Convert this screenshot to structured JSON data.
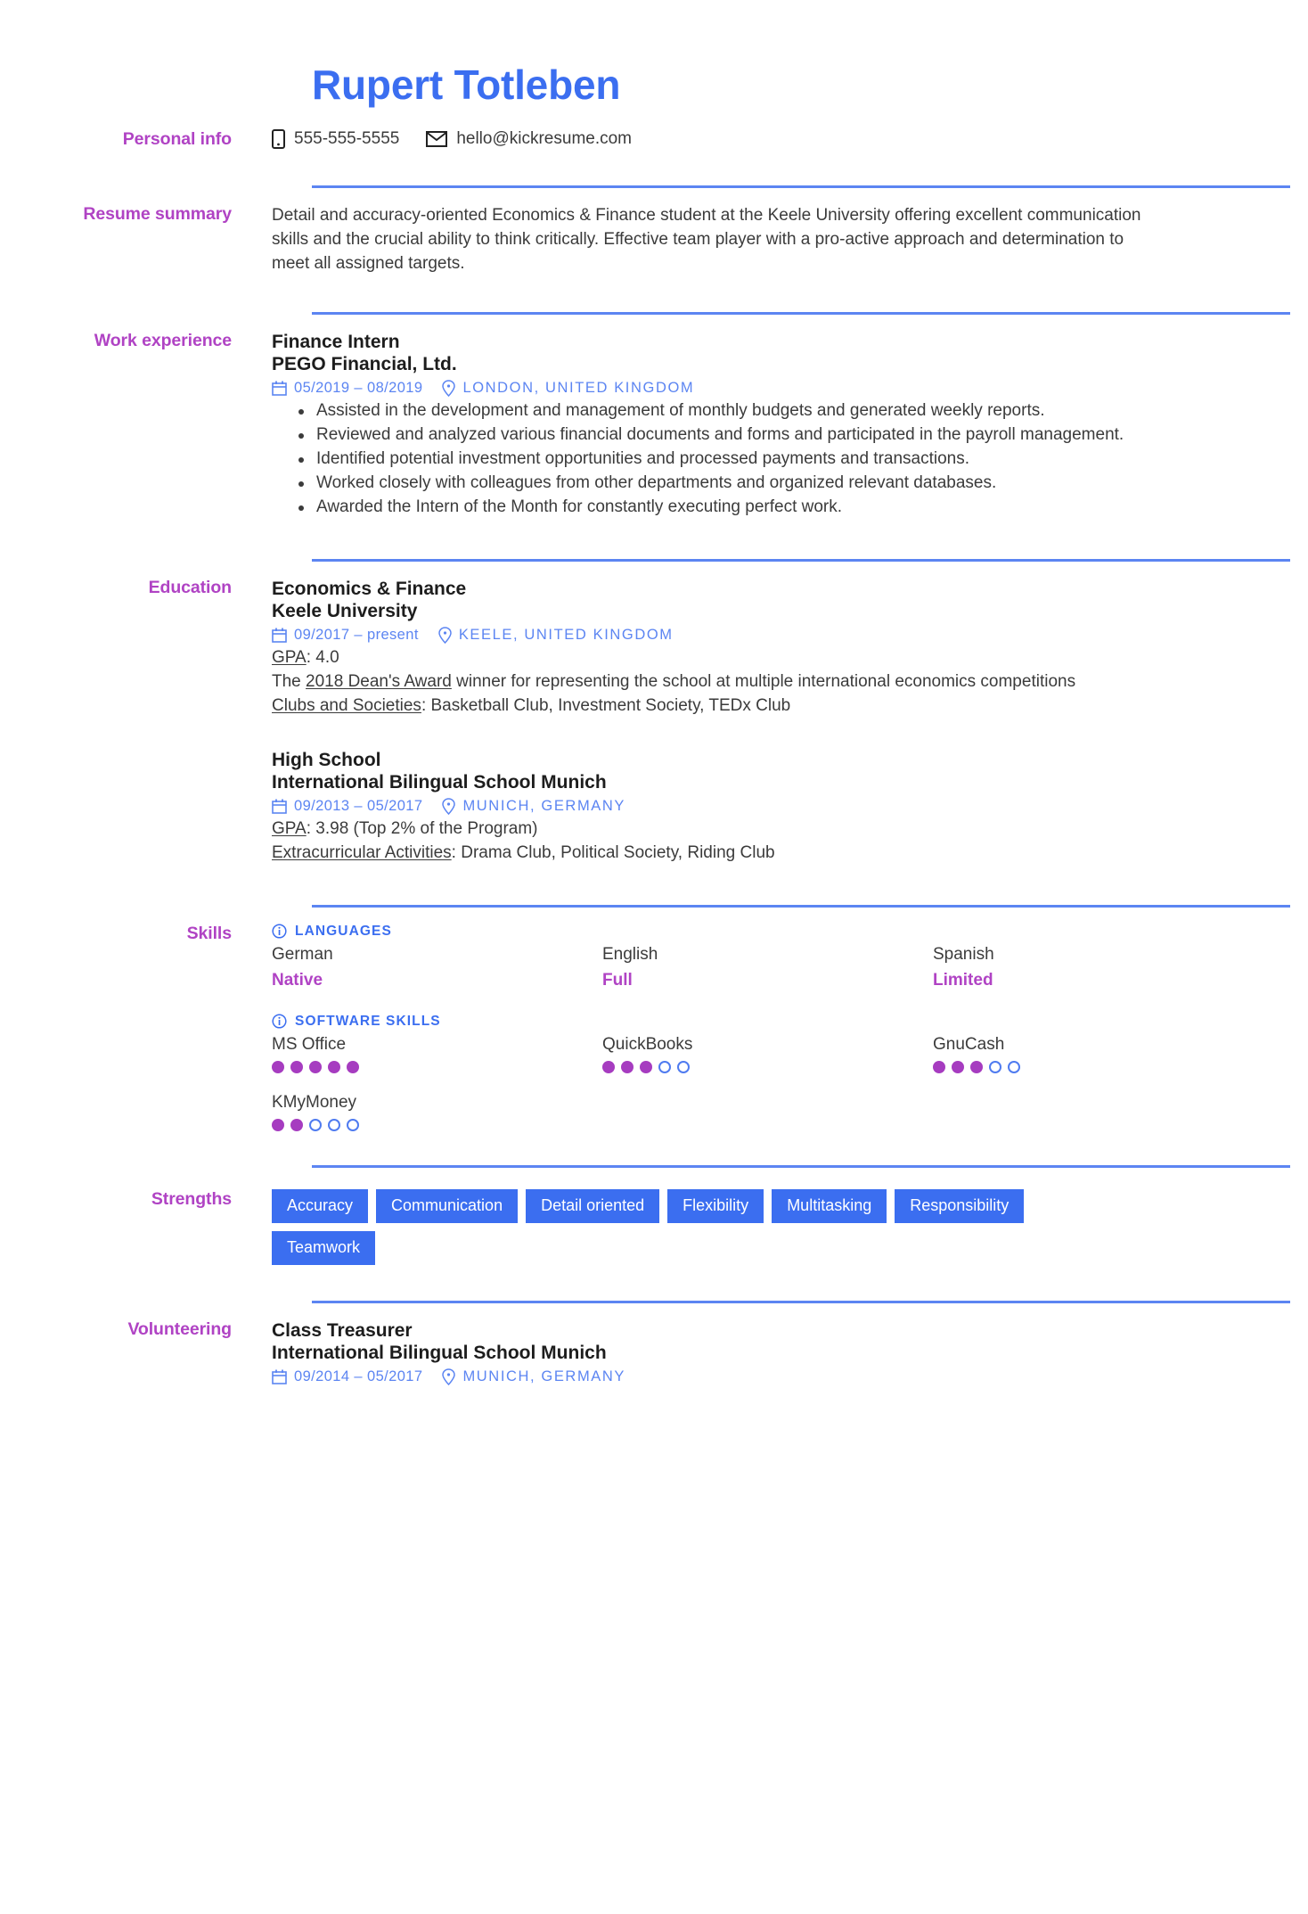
{
  "header": {
    "name": "Rupert Totleben"
  },
  "sections": {
    "personal_info": {
      "label": "Personal info",
      "phone_icon": "phone-icon",
      "phone": "555-555-5555",
      "email_icon": "envelope-icon",
      "email": "hello@kickresume.com"
    },
    "resume_summary": {
      "label": "Resume summary",
      "text": "Detail and accuracy-oriented Economics & Finance student at the Keele University offering excellent communication skills and the crucial ability to think critically. Effective team player with a pro-active approach and determination to meet all assigned targets."
    },
    "work_experience": {
      "label": "Work experience",
      "entries": [
        {
          "title": "Finance Intern",
          "org": "PEGO Financial, Ltd.",
          "date": "05/2019 – 08/2019",
          "location": "LONDON, UNITED KINGDOM",
          "bullets": [
            "Assisted in the development and management of monthly budgets and generated weekly reports.",
            "Reviewed and analyzed various financial documents and forms and participated in the payroll management.",
            "Identified potential investment opportunities and processed payments and transactions.",
            "Worked closely with colleagues from other departments and organized relevant databases.",
            "Awarded the Intern of the Month for constantly executing perfect work."
          ]
        }
      ]
    },
    "education": {
      "label": "Education",
      "entries": [
        {
          "title": "Economics & Finance",
          "org": "Keele University",
          "date": "09/2017 – present",
          "location": "KEELE, UNITED KINGDOM",
          "gpa_label": "GPA",
          "gpa_value": ": 4.0",
          "award_prefix": "The ",
          "award_link": "2018 Dean's Award",
          "award_suffix": " winner for representing the school at multiple international economics competitions",
          "clubs_label": "Clubs and Societies",
          "clubs_value": ": Basketball Club, Investment Society, TEDx Club"
        },
        {
          "title": "High School",
          "org": "International Bilingual School Munich",
          "date": "09/2013 – 05/2017",
          "location": "MUNICH, GERMANY",
          "gpa_label": "GPA",
          "gpa_value": ": 3.98 (Top 2% of the Program)",
          "extra_label": "Extracurricular Activities",
          "extra_value": ": Drama Club, Political Society, Riding Club"
        }
      ]
    },
    "skills": {
      "label": "Skills",
      "languages": {
        "heading": "LANGUAGES",
        "info_icon": "info-icon",
        "items": [
          {
            "name": "German",
            "level": "Native"
          },
          {
            "name": "English",
            "level": "Full"
          },
          {
            "name": "Spanish",
            "level": "Limited"
          }
        ]
      },
      "software": {
        "heading": "SOFTWARE SKILLS",
        "info_icon": "info-icon",
        "max_dots": 5,
        "items": [
          {
            "name": "MS Office",
            "rating": 5
          },
          {
            "name": "QuickBooks",
            "rating": 3
          },
          {
            "name": "GnuCash",
            "rating": 3
          },
          {
            "name": "KMyMoney",
            "rating": 2
          }
        ]
      }
    },
    "strengths": {
      "label": "Strengths",
      "tags": [
        "Accuracy",
        "Communication",
        "Detail oriented",
        "Flexibility",
        "Multitasking",
        "Responsibility",
        "Teamwork"
      ]
    },
    "volunteering": {
      "label": "Volunteering",
      "entries": [
        {
          "title": "Class Treasurer",
          "org": "International Bilingual School Munich",
          "date": "09/2014 – 05/2017",
          "location": "MUNICH, GERMANY"
        }
      ]
    }
  },
  "colors": {
    "accent_blue": "#3b6ef0",
    "label_purple": "#b043c4",
    "dot_filled": "#a63cc0",
    "text": "#3b3b3b"
  }
}
